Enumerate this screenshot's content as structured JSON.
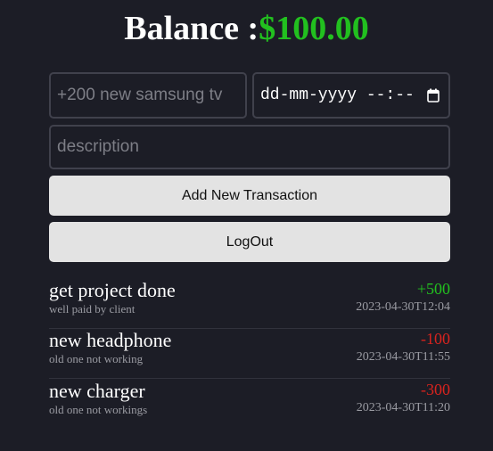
{
  "header": {
    "balance_label": "Balance :",
    "balance_amount": "$100.00"
  },
  "form": {
    "name_placeholder": "+200 new samsung tv",
    "date_placeholder": "dd-mm-yyyy --:--",
    "description_placeholder": "description",
    "add_button_label": "Add New Transaction",
    "logout_button_label": "LogOut"
  },
  "transactions": [
    {
      "name": "get project done",
      "description": "well paid by client",
      "amount": "+500",
      "datetime": "2023-04-30T12:04"
    },
    {
      "name": "new headphone",
      "description": "old one not working",
      "amount": "-100",
      "datetime": "2023-04-30T11:55"
    },
    {
      "name": "new charger",
      "description": "old one not workings",
      "amount": "-300",
      "datetime": "2023-04-30T11:20"
    }
  ],
  "colors": {
    "background": "#1c1d26",
    "positive": "#22c01f",
    "negative": "#d9231e",
    "button": "#e3e3e3"
  },
  "icons": {
    "date_picker": "calendar-icon"
  }
}
